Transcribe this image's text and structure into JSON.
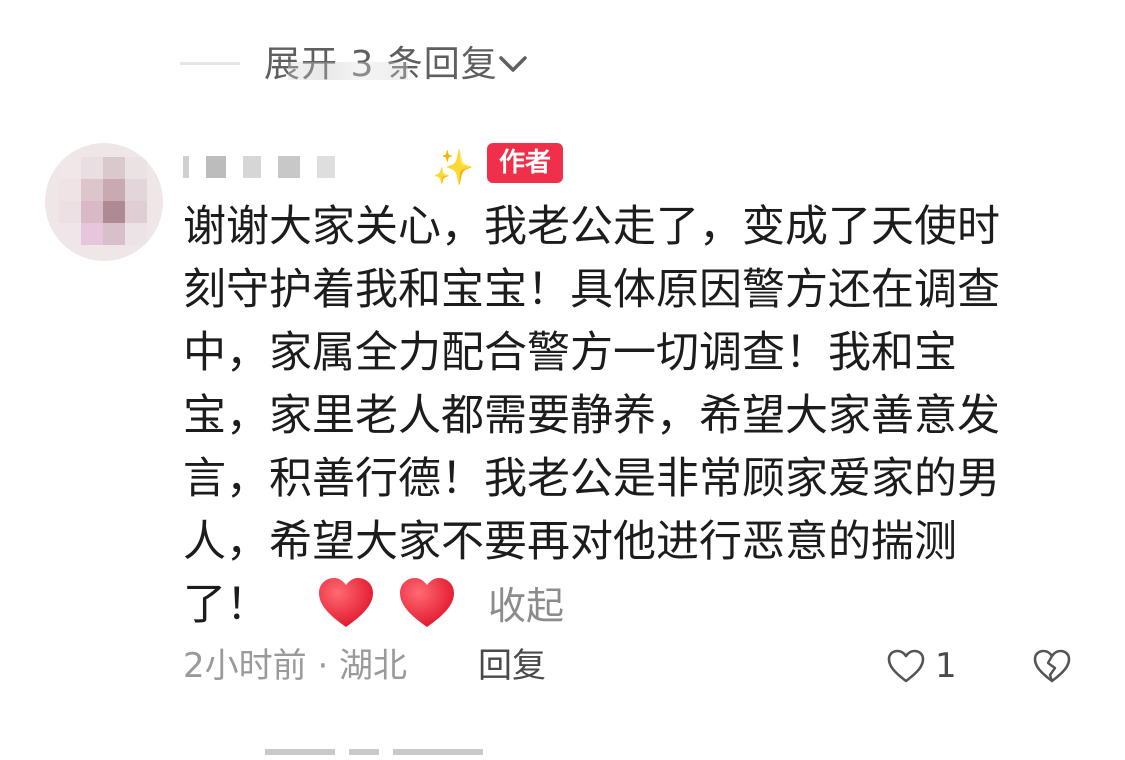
{
  "top_thread": {
    "expand_label": "展开 3 条回复"
  },
  "comment": {
    "author_badge": "作者",
    "body_lines": [
      "谢谢大家关心，我老公走了，变成了天使时",
      "刻守护着我和宝宝！具体原因警方还在调查",
      "中，家属全力配合警方一切调查！我和宝",
      "宝，家里老人都需要静养，希望大家善意发",
      "言，积善行德！我老公是非常顾家爱家的男",
      "人，希望大家不要再对他进行恶意的揣测",
      "了！"
    ],
    "collapse_label": "收起",
    "timestamp": "2小时前 · 湖北",
    "reply_label": "回复",
    "like_count": "1"
  },
  "icons": {
    "sparkle": "sparkle-icon",
    "heart": "red-heart-emoji",
    "like": "heart-outline-icon",
    "dislike": "broken-heart-outline-icon",
    "chevron": "chevron-down-icon"
  },
  "colors": {
    "badge_bg": "#f0304a",
    "heart_red": "#f22d3f",
    "text_primary": "#1c1c1c",
    "text_secondary": "#9a9a9a"
  }
}
